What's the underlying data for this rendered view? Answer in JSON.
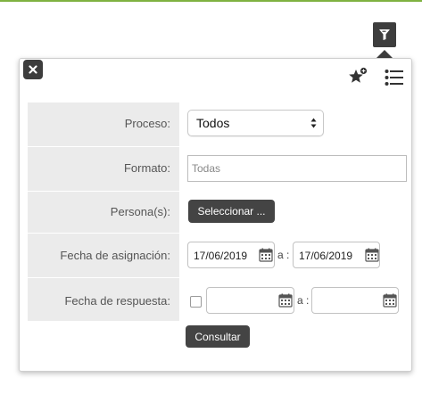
{
  "panel": {
    "close_icon": "close-icon",
    "favorite_icon": "star-plus-icon",
    "list_icon": "list-icon",
    "filter_icon": "filter-icon"
  },
  "form": {
    "proceso": {
      "label": "Proceso:",
      "value": "Todos"
    },
    "formato": {
      "label": "Formato:",
      "placeholder": "Todas",
      "value": ""
    },
    "personas": {
      "label": "Persona(s):",
      "button": "Seleccionar ..."
    },
    "fecha_asignacion": {
      "label": "Fecha de asignación:",
      "from": "17/06/2019",
      "separator": "a :",
      "to": "17/06/2019"
    },
    "fecha_respuesta": {
      "label": "Fecha de respuesta:",
      "checked": false,
      "from": "",
      "separator": "a :",
      "to": ""
    },
    "submit": "Consultar"
  },
  "colors": {
    "accent_line": "#7fb241",
    "dark_button": "#444444",
    "label_background": "#ebebeb"
  }
}
